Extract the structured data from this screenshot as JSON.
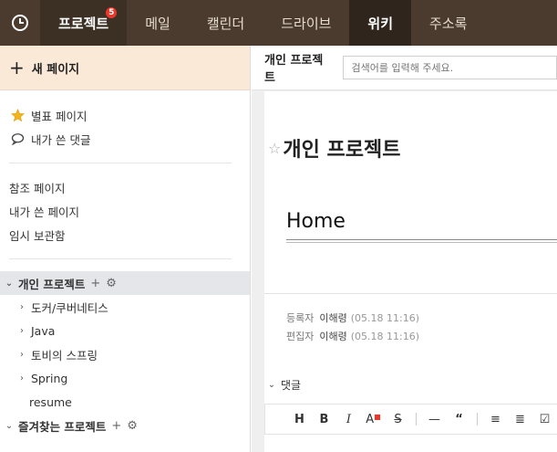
{
  "nav": {
    "items": [
      {
        "label": "프로젝트",
        "badge": "5"
      },
      {
        "label": "메일"
      },
      {
        "label": "캘린더"
      },
      {
        "label": "드라이브"
      },
      {
        "label": "위키"
      },
      {
        "label": "주소록"
      }
    ]
  },
  "sidebar": {
    "new_page": "새 페이지",
    "favorites": "별표 페이지",
    "my_comments": "내가 쓴 댓글",
    "links": [
      "참조 페이지",
      "내가 쓴 페이지",
      "임시 보관함"
    ],
    "tree": {
      "project": "개인 프로젝트",
      "children": [
        "도커/쿠버네티스",
        "Java",
        "토비의 스프링",
        "Spring"
      ],
      "leaf": "resume",
      "favorite_projects": "즐겨찾는 프로젝트"
    }
  },
  "main": {
    "header_title": "개인 프로젝트",
    "search_placeholder": "검색어를 입력해 주세요.",
    "doc_title": "개인 프로젝트",
    "heading": "Home",
    "registered_label": "등록자",
    "registered_by": "이해령",
    "registered_at": "(05.18 11:16)",
    "edited_label": "편집자",
    "edited_by": "이해령",
    "edited_at": "(05.18 11:16)",
    "comments_label": "댓글"
  },
  "colors": {
    "nav_bg": "#4a3b2e",
    "badge": "#e8382a",
    "new_page_bg": "#fbe9d8",
    "star": "#f2b51f"
  }
}
